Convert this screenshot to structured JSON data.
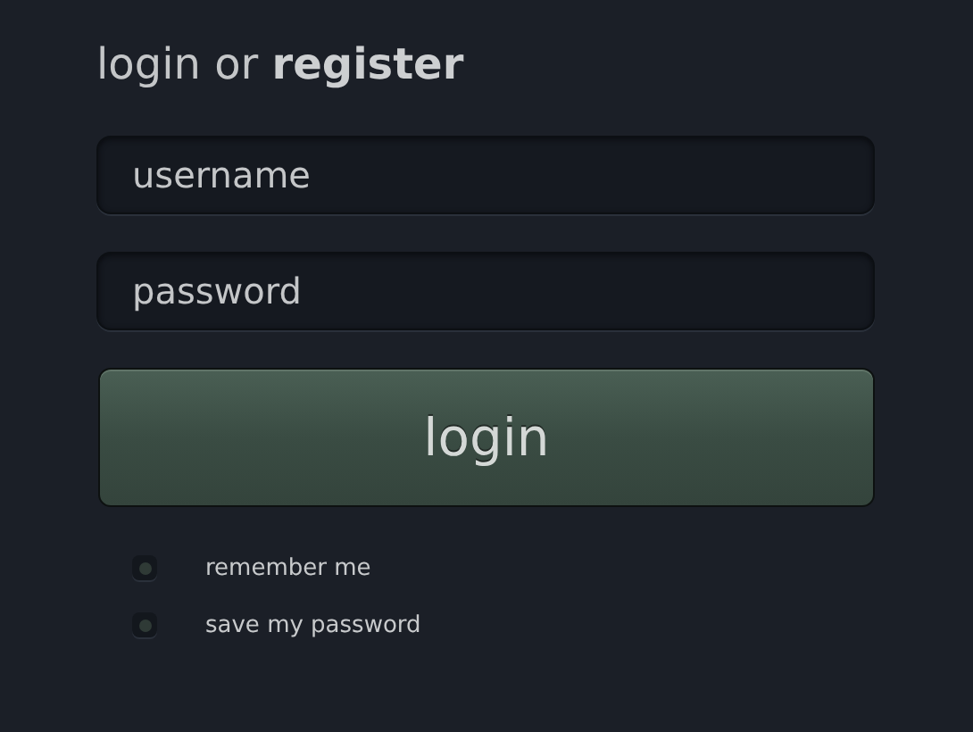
{
  "title": "login or **register**",
  "fields": [
    {
      "placeholder": "username"
    },
    {
      "placeholder": "password"
    }
  ],
  "button": "login",
  "options": [
    {
      "label": "remember me",
      "checked": false
    },
    {
      "label": "save my password",
      "checked": false
    }
  ]
}
